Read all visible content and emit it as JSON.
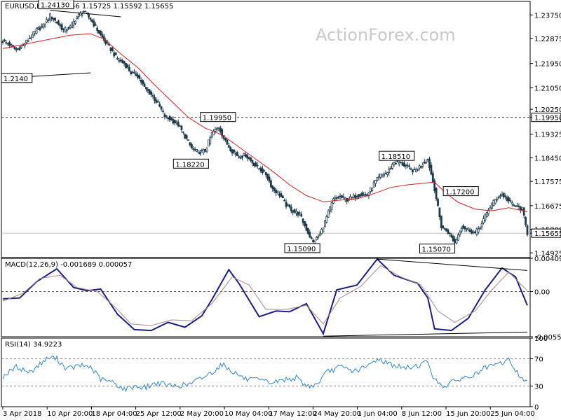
{
  "header": {
    "symbol": "EURUSD,H4",
    "ohlc": "1.15646 1.15725 1.15592 1.15655"
  },
  "watermark": "ActionForex.com",
  "colors": {
    "candle": "#1e3b4a",
    "moving_average": "#d32020",
    "macd_line": "#1a1f86",
    "signal_line": "#b08686",
    "rsi_line": "#2f86c9",
    "trendline": "#000000",
    "last_price_box": "#ffffff",
    "grid": "#888888"
  },
  "chart_data": [
    {
      "name": "price",
      "type": "candlestick",
      "x_labels": [
        "3 Apr 2018",
        "10 Apr 20:00",
        "18 Apr 04:00",
        "25 Apr 12:00",
        "2 May 20:00",
        "10 May 04:00",
        "17 May 12:00",
        "24 May 20:00",
        "1 Jun 04:00",
        "8 Jun 12:00",
        "15 Jun 20:00",
        "25 Jun 04:00"
      ],
      "y_ticks": [
        "1.23750",
        "1.22875",
        "1.21950",
        "1.21050",
        "1.20250",
        "1.19950",
        "1.19325",
        "1.18450",
        "1.17575",
        "1.16675",
        "1.15800",
        "1.15655",
        "1.14925"
      ],
      "ylim": [
        1.1475,
        1.2425
      ],
      "last_price": "1.15655",
      "dashed_level": "1.19950",
      "close_path": [
        [
          0,
          1.2278
        ],
        [
          4,
          1.2265
        ],
        [
          8,
          1.2245
        ],
        [
          12,
          1.2262
        ],
        [
          16,
          1.229
        ],
        [
          20,
          1.2318
        ],
        [
          24,
          1.2335
        ],
        [
          28,
          1.2372
        ],
        [
          32,
          1.2348
        ],
        [
          36,
          1.2318
        ],
        [
          40,
          1.233
        ],
        [
          44,
          1.2368
        ],
        [
          48,
          1.2388
        ],
        [
          52,
          1.236
        ],
        [
          56,
          1.232
        ],
        [
          60,
          1.228
        ],
        [
          64,
          1.2248
        ],
        [
          68,
          1.221
        ],
        [
          72,
          1.2195
        ],
        [
          76,
          1.216
        ],
        [
          80,
          1.215
        ],
        [
          84,
          1.2105
        ],
        [
          88,
          1.208
        ],
        [
          92,
          1.2045
        ],
        [
          96,
          1.2
        ],
        [
          100,
          1.1985
        ],
        [
          104,
          1.1968
        ],
        [
          108,
          1.1925
        ],
        [
          112,
          1.188
        ],
        [
          116,
          1.1865
        ],
        [
          120,
          1.1872
        ],
        [
          124,
          1.1935
        ],
        [
          128,
          1.196
        ],
        [
          132,
          1.1905
        ],
        [
          136,
          1.187
        ],
        [
          140,
          1.185
        ],
        [
          144,
          1.1855
        ],
        [
          148,
          1.1828
        ],
        [
          152,
          1.1805
        ],
        [
          156,
          1.1785
        ],
        [
          160,
          1.173
        ],
        [
          164,
          1.171
        ],
        [
          168,
          1.167
        ],
        [
          172,
          1.1648
        ],
        [
          176,
          1.1635
        ],
        [
          180,
          1.158
        ],
        [
          184,
          1.153
        ],
        [
          188,
          1.156
        ],
        [
          192,
          1.1625
        ],
        [
          196,
          1.169
        ],
        [
          200,
          1.17
        ],
        [
          204,
          1.169
        ],
        [
          208,
          1.17
        ],
        [
          212,
          1.171
        ],
        [
          216,
          1.1705
        ],
        [
          220,
          1.175
        ],
        [
          224,
          1.178
        ],
        [
          228,
          1.179
        ],
        [
          232,
          1.183
        ],
        [
          236,
          1.1825
        ],
        [
          240,
          1.181
        ],
        [
          244,
          1.1795
        ],
        [
          248,
          1.1818
        ],
        [
          252,
          1.184
        ],
        [
          256,
          1.173
        ],
        [
          260,
          1.159
        ],
        [
          264,
          1.157
        ],
        [
          268,
          1.153
        ],
        [
          272,
          1.159
        ],
        [
          276,
          1.158
        ],
        [
          280,
          1.1565
        ],
        [
          284,
          1.16
        ],
        [
          288,
          1.1655
        ],
        [
          292,
          1.169
        ],
        [
          296,
          1.171
        ],
        [
          300,
          1.1685
        ],
        [
          304,
          1.1665
        ],
        [
          308,
          1.1655
        ],
        [
          311,
          1.1566
        ]
      ],
      "moving_average_path": [
        [
          0,
          1.225
        ],
        [
          20,
          1.2275
        ],
        [
          40,
          1.23
        ],
        [
          52,
          1.2305
        ],
        [
          60,
          1.2285
        ],
        [
          70,
          1.223
        ],
        [
          80,
          1.218
        ],
        [
          90,
          1.2115
        ],
        [
          100,
          1.2055
        ],
        [
          110,
          1.1995
        ],
        [
          120,
          1.1955
        ],
        [
          130,
          1.193
        ],
        [
          140,
          1.1885
        ],
        [
          150,
          1.184
        ],
        [
          160,
          1.1795
        ],
        [
          170,
          1.1745
        ],
        [
          180,
          1.1705
        ],
        [
          190,
          1.1682
        ],
        [
          200,
          1.1688
        ],
        [
          210,
          1.1693
        ],
        [
          220,
          1.1712
        ],
        [
          230,
          1.1735
        ],
        [
          240,
          1.1745
        ],
        [
          248,
          1.175
        ],
        [
          256,
          1.1755
        ],
        [
          262,
          1.1718
        ],
        [
          270,
          1.168
        ],
        [
          280,
          1.1655
        ],
        [
          290,
          1.1648
        ],
        [
          300,
          1.166
        ],
        [
          311,
          1.1645
        ]
      ],
      "trendlines": [
        {
          "from": [
            28,
            1.2392
          ],
          "to": [
            70,
            1.2368
          ]
        },
        {
          "from": [
            0,
            1.214
          ],
          "to": [
            52,
            1.216
          ]
        }
      ],
      "annotations": [
        {
          "text": "1.24130",
          "at": [
            22,
            1.2413
          ]
        },
        {
          "text": "1.2140",
          "at": [
            0,
            1.214
          ]
        },
        {
          "text": "1.19950",
          "at": [
            118,
            1.1995
          ]
        },
        {
          "text": "1.18220",
          "at": [
            102,
            1.1822
          ]
        },
        {
          "text": "1.18510",
          "at": [
            224,
            1.1851
          ]
        },
        {
          "text": "1.17200",
          "at": [
            262,
            1.172
          ]
        },
        {
          "text": "1.15090",
          "at": [
            168,
            1.1509
          ]
        },
        {
          "text": "1.15070",
          "at": [
            248,
            1.1507
          ]
        }
      ]
    },
    {
      "name": "macd",
      "type": "line",
      "title": "MACD(12,26,9) -0.001689 0.000057",
      "y_ticks": [
        "0.004094",
        "0.00",
        "-0.005568"
      ],
      "ylim": [
        -0.005568,
        0.004094
      ],
      "series": [
        {
          "name": "MACD",
          "points": [
            [
              0,
              -0.0009
            ],
            [
              10,
              -0.0008
            ],
            [
              20,
              0.0012
            ],
            [
              32,
              0.0028
            ],
            [
              42,
              0.0005
            ],
            [
              50,
              0.0001
            ],
            [
              58,
              0.0003
            ],
            [
              68,
              -0.0028
            ],
            [
              78,
              -0.0047
            ],
            [
              88,
              -0.0048
            ],
            [
              98,
              -0.0038
            ],
            [
              108,
              -0.0044
            ],
            [
              118,
              -0.003
            ],
            [
              124,
              -0.001
            ],
            [
              134,
              0.0027
            ],
            [
              140,
              0.001
            ],
            [
              152,
              -0.0031
            ],
            [
              162,
              -0.0024
            ],
            [
              170,
              -0.0025
            ],
            [
              180,
              -0.0015
            ],
            [
              190,
              -0.0052
            ],
            [
              198,
              0.0002
            ],
            [
              210,
              0.0008
            ],
            [
              222,
              0.004
            ],
            [
              232,
              0.002
            ],
            [
              246,
              0.001
            ],
            [
              252,
              -0.0008
            ],
            [
              256,
              -0.0046
            ],
            [
              266,
              -0.0048
            ],
            [
              276,
              -0.0033
            ],
            [
              286,
              0.0002
            ],
            [
              296,
              0.0029
            ],
            [
              304,
              0.0018
            ],
            [
              311,
              -0.0017
            ]
          ]
        },
        {
          "name": "Signal",
          "points": [
            [
              0,
              -0.0012
            ],
            [
              12,
              -0.0002
            ],
            [
              22,
              0.0016
            ],
            [
              34,
              0.002
            ],
            [
              44,
              0.0005
            ],
            [
              56,
              0.0
            ],
            [
              66,
              -0.0018
            ],
            [
              76,
              -0.004
            ],
            [
              88,
              -0.0042
            ],
            [
              100,
              -0.0035
            ],
            [
              112,
              -0.0036
            ],
            [
              124,
              -0.0015
            ],
            [
              136,
              0.0018
            ],
            [
              146,
              0.0008
            ],
            [
              156,
              -0.0022
            ],
            [
              168,
              -0.0022
            ],
            [
              180,
              -0.0017
            ],
            [
              190,
              -0.004
            ],
            [
              200,
              -0.0008
            ],
            [
              212,
              0.0006
            ],
            [
              224,
              0.0032
            ],
            [
              236,
              0.0018
            ],
            [
              248,
              0.0008
            ],
            [
              258,
              -0.0024
            ],
            [
              268,
              -0.0038
            ],
            [
              280,
              -0.0024
            ],
            [
              290,
              0.0002
            ],
            [
              300,
              0.0024
            ],
            [
              311,
              0.0001
            ]
          ]
        }
      ],
      "trendlines": [
        {
          "from": [
            222,
            0.004
          ],
          "to": [
            311,
            0.0026
          ]
        },
        {
          "from": [
            190,
            -0.0055
          ],
          "to": [
            311,
            -0.005
          ]
        }
      ]
    },
    {
      "name": "rsi",
      "type": "line",
      "title": "RSI(14) 34.9223",
      "y_ticks": [
        "100",
        "70",
        "30",
        "0"
      ],
      "ylim": [
        0,
        100
      ],
      "dashed_levels": [
        70,
        30
      ],
      "series": [
        {
          "name": "RSI",
          "points": [
            [
              0,
              44
            ],
            [
              8,
              58
            ],
            [
              16,
              50
            ],
            [
              24,
              66
            ],
            [
              28,
              72
            ],
            [
              32,
              70
            ],
            [
              38,
              55
            ],
            [
              46,
              60
            ],
            [
              52,
              58
            ],
            [
              58,
              40
            ],
            [
              66,
              35
            ],
            [
              72,
              25
            ],
            [
              78,
              30
            ],
            [
              84,
              28
            ],
            [
              92,
              35
            ],
            [
              100,
              30
            ],
            [
              110,
              32
            ],
            [
              118,
              42
            ],
            [
              124,
              50
            ],
            [
              130,
              62
            ],
            [
              136,
              52
            ],
            [
              144,
              40
            ],
            [
              152,
              38
            ],
            [
              160,
              35
            ],
            [
              168,
              40
            ],
            [
              174,
              42
            ],
            [
              180,
              30
            ],
            [
              186,
              32
            ],
            [
              192,
              50
            ],
            [
              200,
              58
            ],
            [
              208,
              52
            ],
            [
              216,
              58
            ],
            [
              222,
              70
            ],
            [
              230,
              62
            ],
            [
              238,
              56
            ],
            [
              246,
              60
            ],
            [
              252,
              66
            ],
            [
              256,
              38
            ],
            [
              262,
              30
            ],
            [
              270,
              40
            ],
            [
              278,
              44
            ],
            [
              286,
              56
            ],
            [
              294,
              62
            ],
            [
              300,
              68
            ],
            [
              306,
              46
            ],
            [
              311,
              35
            ]
          ]
        }
      ]
    }
  ]
}
